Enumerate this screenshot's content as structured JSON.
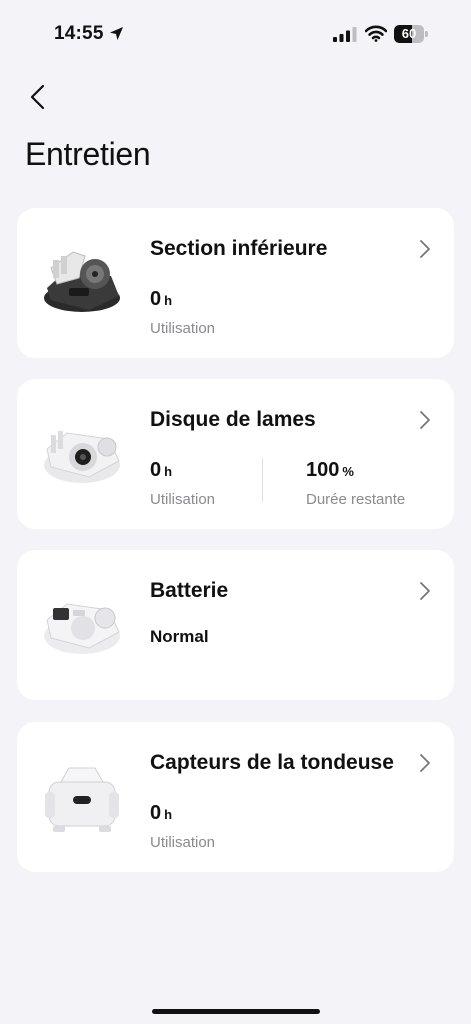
{
  "status_bar": {
    "time": "14:55",
    "battery_level": "60",
    "battery_fraction": 0.6
  },
  "header": {
    "title": "Entretien"
  },
  "cards": [
    {
      "title": "Section inférieure",
      "metrics": [
        {
          "value": "0",
          "unit": "h",
          "label": "Utilisation"
        }
      ]
    },
    {
      "title": "Disque de lames",
      "metrics": [
        {
          "value": "0",
          "unit": "h",
          "label": "Utilisation"
        },
        {
          "value": "100",
          "unit": "%",
          "label": "Durée restante"
        }
      ]
    },
    {
      "title": "Batterie",
      "status": "Normal"
    },
    {
      "title": "Capteurs de la tondeuse",
      "metrics": [
        {
          "value": "0",
          "unit": "h",
          "label": "Utilisation"
        }
      ]
    }
  ],
  "icons": {
    "back": "chevron-left-icon",
    "row_arrow": "chevron-right-icon",
    "location": "location-arrow-icon",
    "signal": "cellular-signal-icon",
    "wifi": "wifi-icon",
    "battery": "battery-icon"
  },
  "colors": {
    "background": "#f3f3f8",
    "card": "#ffffff",
    "text": "#111111",
    "secondary_text": "#8a8a8f"
  }
}
